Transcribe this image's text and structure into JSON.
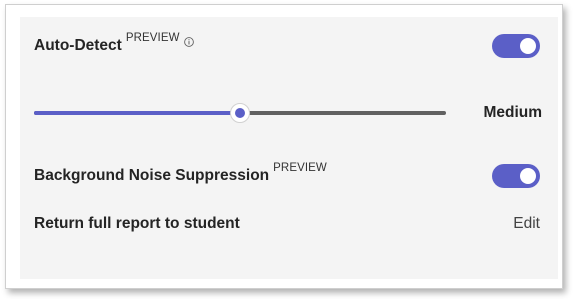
{
  "settings": {
    "auto_detect": {
      "label": "Auto-Detect",
      "badge": "PREVIEW",
      "info_icon": "info-icon",
      "enabled": true
    },
    "sensitivity": {
      "value_label": "Medium",
      "level_fraction": 0.5
    },
    "noise_suppression": {
      "label": "Background Noise Suppression",
      "badge": "PREVIEW",
      "enabled": true
    },
    "full_report": {
      "label": "Return full report to student",
      "action_label": "Edit"
    }
  },
  "colors": {
    "accent": "#5b5fc7",
    "track": "#616161",
    "card_background": "#f4f4f4",
    "text": "#242424"
  }
}
